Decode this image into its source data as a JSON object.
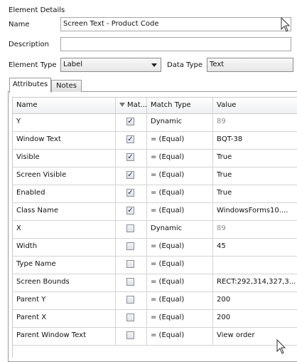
{
  "section_title": "Element Details",
  "name": {
    "label": "Name",
    "value": "Screen Text - Product Code"
  },
  "description": {
    "label": "Description",
    "value": ""
  },
  "element_type": {
    "label": "Element Type",
    "value": "Label"
  },
  "data_type": {
    "label": "Data Type",
    "value": "Text"
  },
  "tabs": [
    {
      "label": "Attributes",
      "active": true
    },
    {
      "label": "Notes",
      "active": false
    }
  ],
  "grid": {
    "columns": [
      "Name",
      "Mat...",
      "Match Type",
      "Value"
    ],
    "rows": [
      {
        "name": "Y",
        "match": true,
        "match_type": "Dynamic",
        "value": "89",
        "value_dim": true
      },
      {
        "name": "Window Text",
        "match": true,
        "match_type": "=  (Equal)",
        "value": "BQT-38",
        "value_dim": false
      },
      {
        "name": "Visible",
        "match": true,
        "match_type": "=  (Equal)",
        "value": "True",
        "value_dim": false
      },
      {
        "name": "Screen Visible",
        "match": true,
        "match_type": "=  (Equal)",
        "value": "True",
        "value_dim": false
      },
      {
        "name": "Enabled",
        "match": true,
        "match_type": "=  (Equal)",
        "value": "True",
        "value_dim": false
      },
      {
        "name": "Class Name",
        "match": true,
        "match_type": "=  (Equal)",
        "value": "WindowsForms10....",
        "value_dim": false
      },
      {
        "name": "X",
        "match": false,
        "match_type": "Dynamic",
        "value": "89",
        "value_dim": true
      },
      {
        "name": "Width",
        "match": false,
        "match_type": "=  (Equal)",
        "value": "45",
        "value_dim": false
      },
      {
        "name": "Type Name",
        "match": false,
        "match_type": "=  (Equal)",
        "value": "",
        "value_dim": false
      },
      {
        "name": "Screen Bounds",
        "match": false,
        "match_type": "=  (Equal)",
        "value": "RECT:292,314,327,3...",
        "value_dim": false
      },
      {
        "name": "Parent Y",
        "match": false,
        "match_type": "=  (Equal)",
        "value": "200",
        "value_dim": false
      },
      {
        "name": "Parent X",
        "match": false,
        "match_type": "=  (Equal)",
        "value": "200",
        "value_dim": false
      },
      {
        "name": "Parent Window Text",
        "match": false,
        "match_type": "=  (Equal)",
        "value": "View order",
        "value_dim": false
      }
    ]
  }
}
